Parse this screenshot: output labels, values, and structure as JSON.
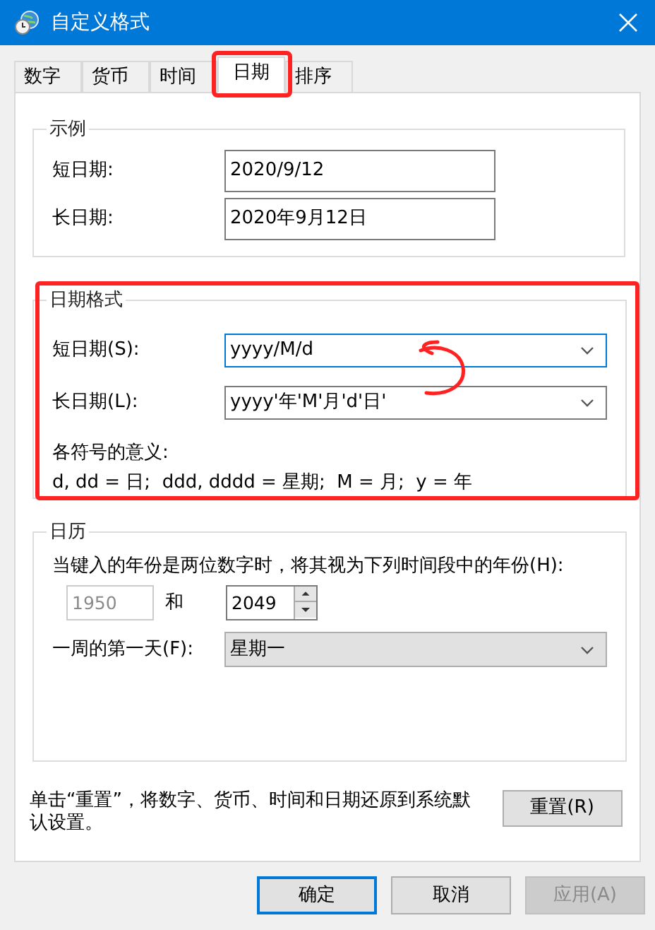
{
  "window": {
    "title": "自定义格式"
  },
  "tabs": [
    {
      "label": "数字",
      "selected": false,
      "highlighted": false
    },
    {
      "label": "货币",
      "selected": false,
      "highlighted": false
    },
    {
      "label": "时间",
      "selected": false,
      "highlighted": false
    },
    {
      "label": "日期",
      "selected": true,
      "highlighted": true
    },
    {
      "label": "排序",
      "selected": false,
      "highlighted": false
    }
  ],
  "example": {
    "title": "示例",
    "rows": [
      {
        "label": "短日期:",
        "value": "2020/9/12"
      },
      {
        "label": "长日期:",
        "value": "2020年9月12日"
      }
    ]
  },
  "date_format": {
    "title": "日期格式",
    "highlighted": true,
    "scribble": true,
    "rows": [
      {
        "label": "短日期(S):",
        "value": "yyyy/M/d",
        "focused": true
      },
      {
        "label": "长日期(L):",
        "value": "yyyy'年'M'月'd'日'",
        "focused": false
      }
    ],
    "legend_title": "各符号的意义:",
    "legend": "d, dd = 日;  ddd, dddd = 星期;  M = 月;  y = 年"
  },
  "calendar": {
    "title": "日历",
    "prompt": "当键入的年份是两位数字时，将其视为下列时间段中的年份(H):",
    "start_year": {
      "value": "1950",
      "disabled": true
    },
    "and": "和",
    "end_year": {
      "value": "2049",
      "disabled": false
    },
    "first_day_label": "一周的第一天(F):",
    "first_day": "星期一"
  },
  "reset_text": "单击“重置”，将数字、货币、时间和日期还原到系统默认设置。",
  "reset_button": "重置(R)",
  "buttons": [
    {
      "label": "确定",
      "default": true,
      "disabled": false
    },
    {
      "label": "取消",
      "default": false,
      "disabled": false
    },
    {
      "label": "应用(A)",
      "default": false,
      "disabled": true
    }
  ]
}
